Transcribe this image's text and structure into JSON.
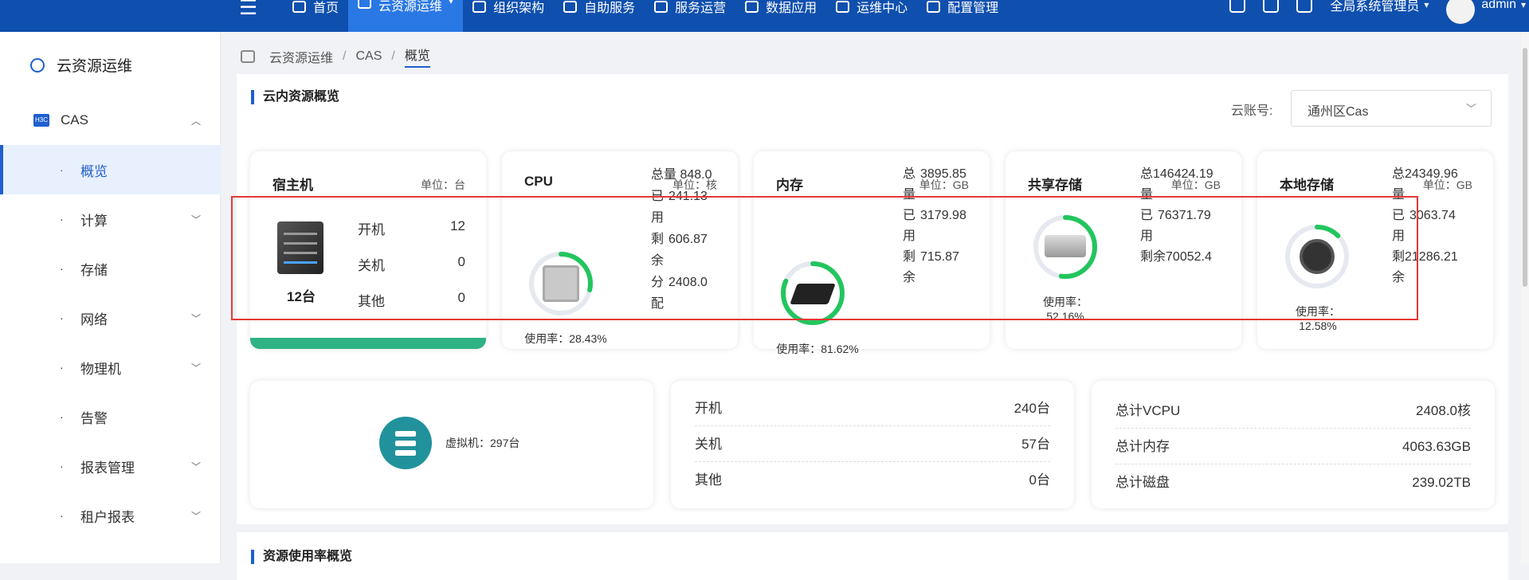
{
  "topbar": {
    "nav": [
      {
        "label": "首页",
        "icon": "camera-icon"
      },
      {
        "label": "云资源运维",
        "icon": "cloud-icon",
        "active": true
      },
      {
        "label": "组织架构",
        "icon": "layers-icon"
      },
      {
        "label": "自助服务",
        "icon": "edit-icon"
      },
      {
        "label": "服务运营",
        "icon": "gear-icon"
      },
      {
        "label": "数据应用",
        "icon": "chart-icon"
      },
      {
        "label": "运维中心",
        "icon": "monitor-icon"
      },
      {
        "label": "配置管理",
        "icon": "settings-icon"
      }
    ],
    "role": "全局系统管理员",
    "user": "admin",
    "colors": {
      "bar": "#0f4fae",
      "active": "#2a78e4"
    }
  },
  "sidebar": {
    "title": "云资源运维",
    "items": [
      {
        "label": "CAS",
        "badge": "H3C"
      },
      {
        "label": "概览"
      },
      {
        "label": "计算"
      },
      {
        "label": "存储"
      },
      {
        "label": "网络"
      },
      {
        "label": "物理机"
      },
      {
        "label": "告警"
      },
      {
        "label": "报表管理"
      },
      {
        "label": "租户报表"
      }
    ]
  },
  "breadcrumb": [
    "云资源运维",
    "CAS",
    "概览"
  ],
  "overview": {
    "title": "云内资源概览",
    "account_label": "云账号:",
    "account_value": "通州区Cas",
    "host": {
      "title": "宿主机",
      "unit": "单位：台",
      "total": "12台",
      "rows": [
        {
          "label": "开机",
          "value": "12"
        },
        {
          "label": "关机",
          "value": "0"
        },
        {
          "label": "其他",
          "value": "0"
        }
      ]
    },
    "cpu": {
      "title": "CPU",
      "unit": "单位：核",
      "usage": "使用率：28.43%",
      "percent": 28.43,
      "stats": [
        {
          "label": "总量",
          "value": "848.0"
        },
        {
          "label": "已用",
          "value": "241.13"
        },
        {
          "label": "剩余",
          "value": "606.87"
        },
        {
          "label": "分配",
          "value": "2408.0"
        }
      ]
    },
    "memory": {
      "title": "内存",
      "unit": "单位：GB",
      "usage": "使用率：81.62%",
      "percent": 81.62,
      "stats": [
        {
          "label": "总量",
          "value": "3895.85"
        },
        {
          "label": "已用",
          "value": "3179.98"
        },
        {
          "label": "剩余",
          "value": "715.87"
        }
      ]
    },
    "shared": {
      "title": "共享存储",
      "unit": "单位：GB",
      "usage": "使用率：52.16%",
      "percent": 52.16,
      "stats": [
        {
          "label": "总量",
          "value": "146424.19"
        },
        {
          "label": "已用",
          "value": "76371.79"
        },
        {
          "label": "剩余",
          "value": "70052.4"
        }
      ]
    },
    "local": {
      "title": "本地存储",
      "unit": "单位：GB",
      "usage": "使用率：12.58%",
      "percent": 12.58,
      "stats": [
        {
          "label": "总量",
          "value": "24349.96"
        },
        {
          "label": "已用",
          "value": "3063.74"
        },
        {
          "label": "剩余",
          "value": "21286.21"
        }
      ]
    },
    "vm": {
      "label": "虚拟机：297台",
      "rows": [
        {
          "label": "开机",
          "value": "240台"
        },
        {
          "label": "关机",
          "value": "57台"
        },
        {
          "label": "其他",
          "value": "0台"
        }
      ]
    },
    "totals": [
      {
        "label": "总计VCPU",
        "value": "2408.0核"
      },
      {
        "label": "总计内存",
        "value": "4063.63GB"
      },
      {
        "label": "总计磁盘",
        "value": "239.02TB"
      }
    ]
  },
  "usage_section": {
    "title": "资源使用率概览"
  },
  "colors": {
    "gauge": "#22c55e",
    "gauge_track": "#e6e9f0",
    "highlight": "#e53935"
  }
}
